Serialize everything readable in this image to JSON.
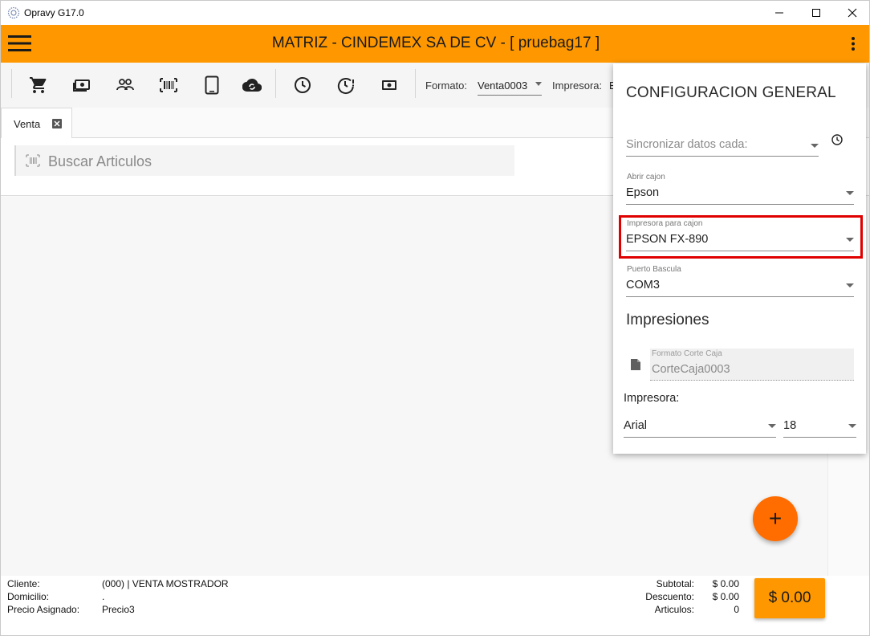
{
  "window": {
    "title": "Opravy G17.0",
    "controls": {
      "minimize": "minimize-icon",
      "maximize": "maximize-icon",
      "close": "close-icon"
    }
  },
  "appbar": {
    "title": "MATRIZ - CINDEMEX SA DE CV - [ pruebag17 ]",
    "accent_color": "#ff9800"
  },
  "toolbar": {
    "icons": [
      "cart-icon",
      "cash-icon",
      "people-icon",
      "barcode-icon",
      "tablet-icon",
      "cloud-sync-icon",
      "clock-icon",
      "clock-alert-icon",
      "money-icon"
    ],
    "formato_label": "Formato:",
    "formato_value": "Venta0003",
    "impresora_label": "Impresora:",
    "impresora_value": "E"
  },
  "tabs": [
    {
      "label": "Venta"
    }
  ],
  "search": {
    "placeholder": "Buscar Articulos"
  },
  "footer": {
    "cliente_label": "Cliente:",
    "cliente_value": "(000) | VENTA MOSTRADOR",
    "domicilio_label": "Domicilio:",
    "domicilio_value": ".",
    "precio_label": "Precio Asignado:",
    "precio_value": "Precio3",
    "subtotal_label": "Subtotal:",
    "subtotal_value": "$ 0.00",
    "descuento_label": "Descuento:",
    "descuento_value": "$ 0.00",
    "articulos_label": "Articulos:",
    "articulos_value": "0",
    "total": "$ 0.00"
  },
  "fab": {
    "label": "+"
  },
  "config_panel": {
    "title": "CONFIGURACION GENERAL",
    "sync_placeholder": "Sincronizar datos cada:",
    "abrir_cajon_label": "Abrir cajon",
    "abrir_cajon_value": "Epson",
    "impresora_cajon_label": "Impresora para cajon",
    "impresora_cajon_value": "EPSON FX-890",
    "puerto_bascula_label": "Puerto Bascula",
    "puerto_bascula_value": "COM3",
    "impresiones_title": "Impresiones",
    "formato_corte_label": "Formato Corte Caja",
    "formato_corte_value": "CorteCaja0003",
    "impresora_label": "Impresora:",
    "font_value": "Arial",
    "size_value": "18",
    "highlight_color": "#e00000"
  }
}
